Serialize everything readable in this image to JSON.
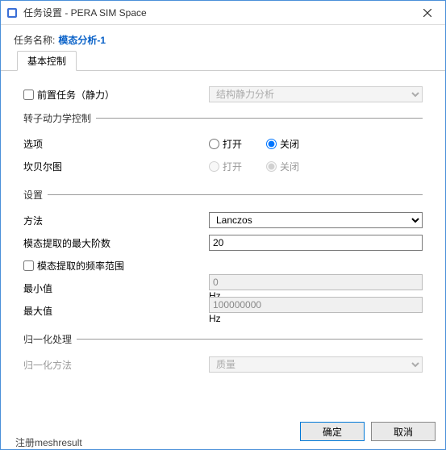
{
  "titlebar": {
    "title": "任务设置 - PERA SIM Space"
  },
  "task_name": {
    "label": "任务名称:",
    "value": "模态分析-1"
  },
  "tabs": {
    "basic": "基本控制"
  },
  "pre_task": {
    "label": "前置任务（静力）",
    "dropdown": "结构静力分析"
  },
  "rotor": {
    "legend": "转子动力学控制",
    "option_label": "选项",
    "open": "打开",
    "close": "关闭",
    "campbell_label": "坎贝尔图"
  },
  "settings": {
    "legend": "设置",
    "method_label": "方法",
    "method_value": "Lanczos",
    "max_order_label": "模态提取的最大阶数",
    "max_order_value": "20",
    "freq_range_label": "模态提取的频率范围",
    "min_label": "最小值",
    "min_value": "0",
    "max_label": "最大值",
    "max_value": "100000000",
    "unit": "Hz"
  },
  "normalize": {
    "legend": "归一化处理",
    "method_label": "归一化方法",
    "method_value": "质量"
  },
  "buttons": {
    "ok": "确定",
    "cancel": "取消"
  },
  "status": "注册meshresult"
}
